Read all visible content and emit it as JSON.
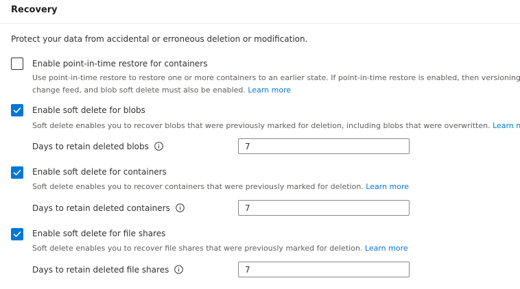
{
  "section": {
    "title": "Recovery",
    "intro": "Protect your data from accidental or erroneous deletion or modification."
  },
  "options": [
    {
      "label": "Enable point-in-time restore for containers",
      "checked": false,
      "description_line1": "Use point-in-time restore to restore one or more containers to an earlier state. If point-in-time restore is enabled, then versioning,",
      "description_line2": "change feed, and blob soft delete must also be enabled.",
      "link": "Learn more"
    },
    {
      "label": "Enable soft delete for blobs",
      "checked": true,
      "description": "Soft delete enables you to recover blobs that were previously marked for deletion, including blobs that were overwritten.",
      "link": "Learn more",
      "field_label": "Days to retain deleted blobs",
      "field_value": "7"
    },
    {
      "label": "Enable soft delete for containers",
      "checked": true,
      "description": "Soft delete enables you to recover containers that were previously marked for deletion.",
      "link": "Learn more",
      "field_label": "Days to retain deleted containers",
      "field_value": "7"
    },
    {
      "label": "Enable soft delete for file shares",
      "checked": true,
      "description": "Soft delete enables you to recover file shares that were previously marked for deletion.",
      "link": "Learn more",
      "field_label": "Days to retain deleted file shares",
      "field_value": "7"
    }
  ],
  "colors": {
    "accent": "#0078d4",
    "text": "#323130",
    "secondary_text": "#605e5c"
  },
  "icons": {
    "checkmark": "checkmark-icon",
    "info": "info-icon"
  }
}
